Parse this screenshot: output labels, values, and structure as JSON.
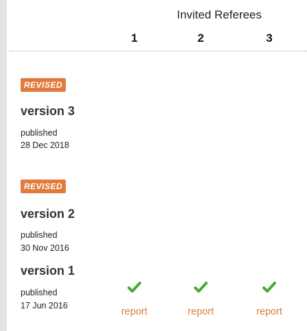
{
  "header": {
    "title": "Invited Referees",
    "columns": [
      "1",
      "2",
      "3"
    ]
  },
  "versions": [
    {
      "badge": "REVISED",
      "title": "version 3",
      "status": "published",
      "date": "28 Dec 2018"
    },
    {
      "badge": "REVISED",
      "title": "version 2",
      "status": "published",
      "date": "30 Nov 2016"
    },
    {
      "badge": "",
      "title": "version 1",
      "status": "published",
      "date": "17 Jun 2016",
      "reports": [
        {
          "status_icon": "check-icon",
          "label": "report"
        },
        {
          "status_icon": "check-icon",
          "label": "report"
        },
        {
          "status_icon": "check-icon",
          "label": "report"
        }
      ]
    }
  ],
  "colors": {
    "accent": "#e07b3e",
    "check": "#4aa63a"
  }
}
